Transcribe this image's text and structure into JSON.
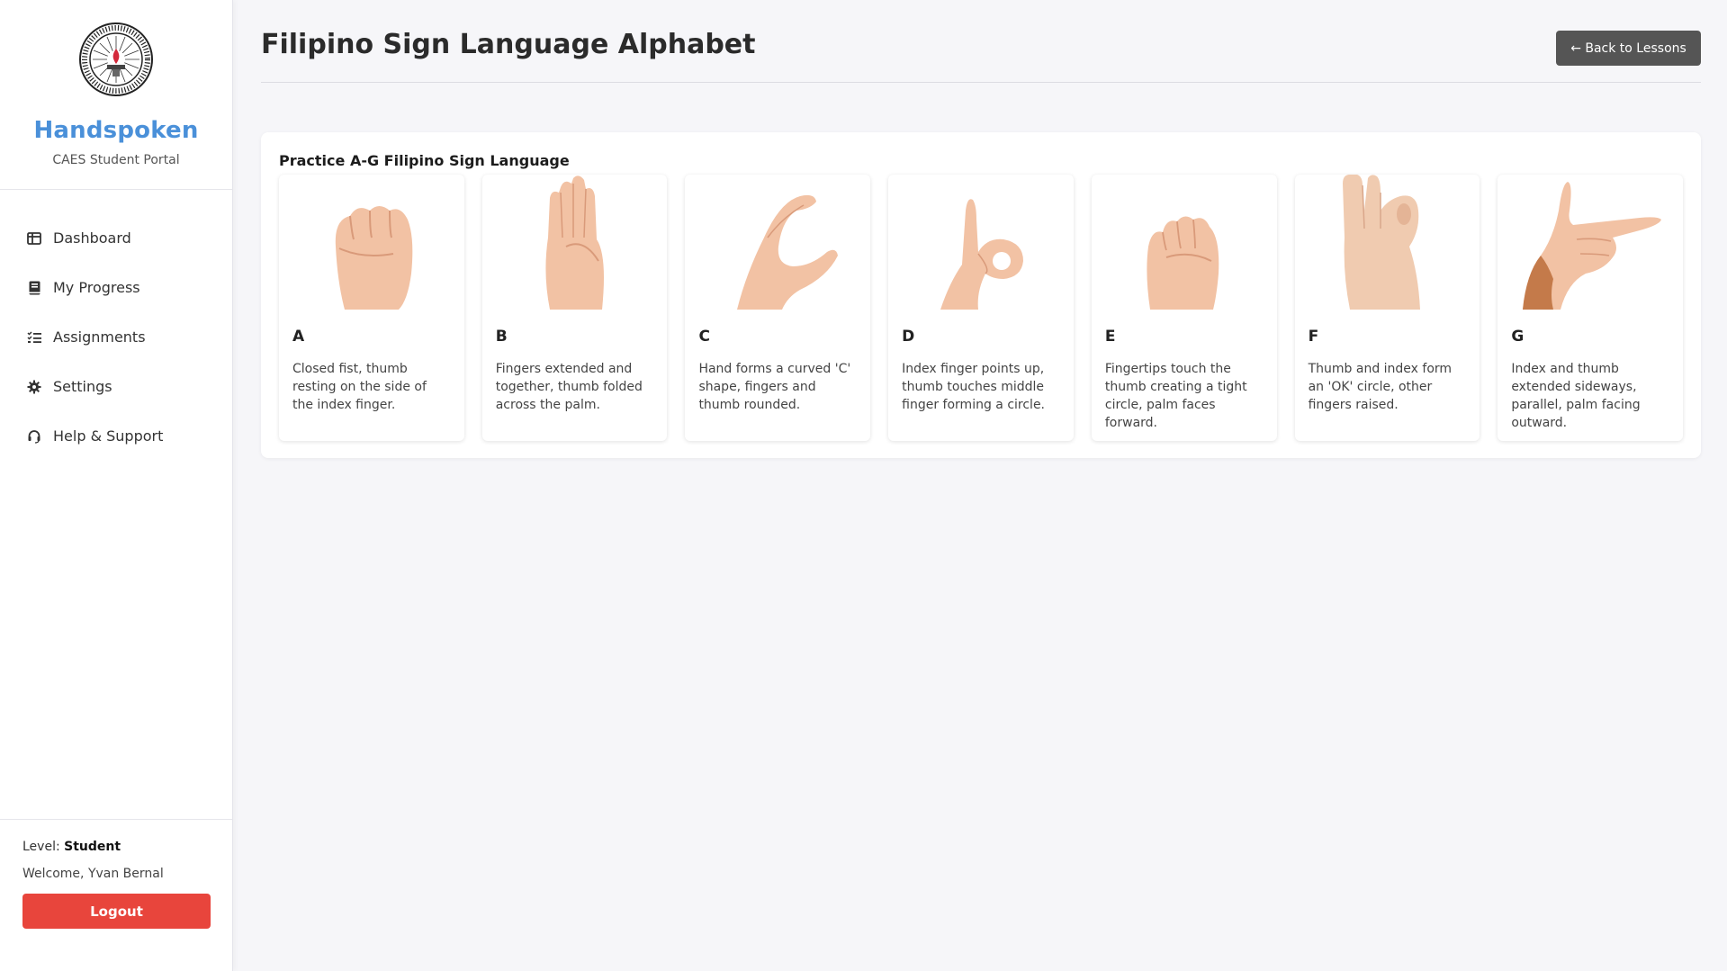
{
  "sidebar": {
    "brand_name": "Handspoken",
    "brand_subtitle": "CAES Student Portal",
    "logo_icon": "school-seal-logo",
    "logo_text": "PAARALANG ELEMENTARYA NG CECILIO APOSTOL · CALOOCAN",
    "nav": [
      {
        "label": "Dashboard",
        "icon": "dashboard-icon"
      },
      {
        "label": "My Progress",
        "icon": "book-icon"
      },
      {
        "label": "Assignments",
        "icon": "checklist-icon"
      },
      {
        "label": "Settings",
        "icon": "gear-icon"
      },
      {
        "label": "Help & Support",
        "icon": "headset-icon"
      }
    ],
    "footer": {
      "level_label": "Level:",
      "level_value": "Student",
      "welcome": "Welcome, Yvan Bernal",
      "logout_label": "Logout"
    }
  },
  "header": {
    "title": "Filipino Sign Language Alphabet",
    "back_label": "← Back to Lessons"
  },
  "practice": {
    "title": "Practice A-G Filipino Sign Language",
    "cards": [
      {
        "letter": "A",
        "description": "Closed fist, thumb resting on the side of the index finger.",
        "image": "hand-sign-a"
      },
      {
        "letter": "B",
        "description": "Fingers extended and together, thumb folded across the palm.",
        "image": "hand-sign-b"
      },
      {
        "letter": "C",
        "description": "Hand forms a curved 'C' shape, fingers and thumb rounded.",
        "image": "hand-sign-c"
      },
      {
        "letter": "D",
        "description": "Index finger points up, thumb touches middle finger forming a circle.",
        "image": "hand-sign-d"
      },
      {
        "letter": "E",
        "description": "Fingertips touch the thumb creating a tight circle, palm faces forward.",
        "image": "hand-sign-e"
      },
      {
        "letter": "F",
        "description": "Thumb and index form an 'OK' circle, other fingers raised.",
        "image": "hand-sign-f"
      },
      {
        "letter": "G",
        "description": "Index and thumb extended sideways, parallel, palm facing outward.",
        "image": "hand-sign-g"
      }
    ]
  },
  "colors": {
    "brand": "#4a90d9",
    "logout": "#e8453c",
    "back_button": "#555555",
    "skin": "#f2c2a4",
    "skin_dark": "#c47a4a"
  }
}
